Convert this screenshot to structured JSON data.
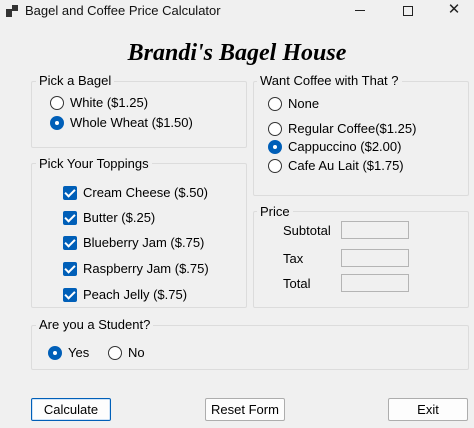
{
  "window": {
    "title": "Bagel and Coffee Price Calculator",
    "close_glyph": "✕"
  },
  "heading": "Brandi's Bagel House",
  "bagel_group": {
    "title": "Pick a Bagel",
    "options": [
      {
        "label": "White ($1.25)",
        "checked": false
      },
      {
        "label": "Whole Wheat ($1.50)",
        "checked": true
      }
    ]
  },
  "coffee_group": {
    "title": "Want Coffee with That ?",
    "options": [
      {
        "label": "None",
        "checked": false
      },
      {
        "label": "Regular Coffee($1.25)",
        "checked": false
      },
      {
        "label": "Cappuccino ($2.00)",
        "checked": true
      },
      {
        "label": "Cafe Au Lait ($1.75)",
        "checked": false
      }
    ]
  },
  "toppings_group": {
    "title": "Pick Your Toppings",
    "items": [
      {
        "label": "Cream Cheese ($.50)",
        "checked": true
      },
      {
        "label": "Butter ($.25)",
        "checked": true
      },
      {
        "label": "Blueberry Jam ($.75)",
        "checked": true
      },
      {
        "label": "Raspberry Jam ($.75)",
        "checked": true
      },
      {
        "label": "Peach Jelly ($.75)",
        "checked": true
      }
    ]
  },
  "price_group": {
    "title": "Price",
    "subtotal_label": "Subtotal",
    "subtotal_value": "",
    "tax_label": "Tax",
    "tax_value": "",
    "total_label": "Total",
    "total_value": ""
  },
  "student_group": {
    "title": "Are you a Student?",
    "options": [
      {
        "label": "Yes",
        "checked": true
      },
      {
        "label": "No",
        "checked": false
      }
    ]
  },
  "buttons": {
    "calculate": "Calculate",
    "reset": "Reset Form",
    "exit": "Exit"
  },
  "colors": {
    "accent": "#005fb8",
    "background": "#f0f0f0"
  }
}
